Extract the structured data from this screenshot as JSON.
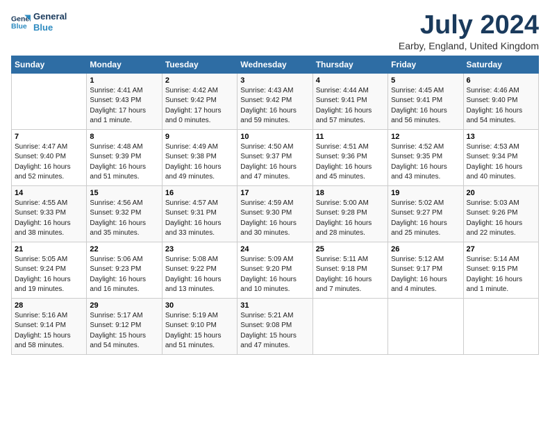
{
  "logo": {
    "line1": "General",
    "line2": "Blue"
  },
  "title": "July 2024",
  "subtitle": "Earby, England, United Kingdom",
  "weekdays": [
    "Sunday",
    "Monday",
    "Tuesday",
    "Wednesday",
    "Thursday",
    "Friday",
    "Saturday"
  ],
  "weeks": [
    [
      {
        "day": "",
        "info": ""
      },
      {
        "day": "1",
        "info": "Sunrise: 4:41 AM\nSunset: 9:43 PM\nDaylight: 17 hours\nand 1 minute."
      },
      {
        "day": "2",
        "info": "Sunrise: 4:42 AM\nSunset: 9:42 PM\nDaylight: 17 hours\nand 0 minutes."
      },
      {
        "day": "3",
        "info": "Sunrise: 4:43 AM\nSunset: 9:42 PM\nDaylight: 16 hours\nand 59 minutes."
      },
      {
        "day": "4",
        "info": "Sunrise: 4:44 AM\nSunset: 9:41 PM\nDaylight: 16 hours\nand 57 minutes."
      },
      {
        "day": "5",
        "info": "Sunrise: 4:45 AM\nSunset: 9:41 PM\nDaylight: 16 hours\nand 56 minutes."
      },
      {
        "day": "6",
        "info": "Sunrise: 4:46 AM\nSunset: 9:40 PM\nDaylight: 16 hours\nand 54 minutes."
      }
    ],
    [
      {
        "day": "7",
        "info": "Sunrise: 4:47 AM\nSunset: 9:40 PM\nDaylight: 16 hours\nand 52 minutes."
      },
      {
        "day": "8",
        "info": "Sunrise: 4:48 AM\nSunset: 9:39 PM\nDaylight: 16 hours\nand 51 minutes."
      },
      {
        "day": "9",
        "info": "Sunrise: 4:49 AM\nSunset: 9:38 PM\nDaylight: 16 hours\nand 49 minutes."
      },
      {
        "day": "10",
        "info": "Sunrise: 4:50 AM\nSunset: 9:37 PM\nDaylight: 16 hours\nand 47 minutes."
      },
      {
        "day": "11",
        "info": "Sunrise: 4:51 AM\nSunset: 9:36 PM\nDaylight: 16 hours\nand 45 minutes."
      },
      {
        "day": "12",
        "info": "Sunrise: 4:52 AM\nSunset: 9:35 PM\nDaylight: 16 hours\nand 43 minutes."
      },
      {
        "day": "13",
        "info": "Sunrise: 4:53 AM\nSunset: 9:34 PM\nDaylight: 16 hours\nand 40 minutes."
      }
    ],
    [
      {
        "day": "14",
        "info": "Sunrise: 4:55 AM\nSunset: 9:33 PM\nDaylight: 16 hours\nand 38 minutes."
      },
      {
        "day": "15",
        "info": "Sunrise: 4:56 AM\nSunset: 9:32 PM\nDaylight: 16 hours\nand 35 minutes."
      },
      {
        "day": "16",
        "info": "Sunrise: 4:57 AM\nSunset: 9:31 PM\nDaylight: 16 hours\nand 33 minutes."
      },
      {
        "day": "17",
        "info": "Sunrise: 4:59 AM\nSunset: 9:30 PM\nDaylight: 16 hours\nand 30 minutes."
      },
      {
        "day": "18",
        "info": "Sunrise: 5:00 AM\nSunset: 9:28 PM\nDaylight: 16 hours\nand 28 minutes."
      },
      {
        "day": "19",
        "info": "Sunrise: 5:02 AM\nSunset: 9:27 PM\nDaylight: 16 hours\nand 25 minutes."
      },
      {
        "day": "20",
        "info": "Sunrise: 5:03 AM\nSunset: 9:26 PM\nDaylight: 16 hours\nand 22 minutes."
      }
    ],
    [
      {
        "day": "21",
        "info": "Sunrise: 5:05 AM\nSunset: 9:24 PM\nDaylight: 16 hours\nand 19 minutes."
      },
      {
        "day": "22",
        "info": "Sunrise: 5:06 AM\nSunset: 9:23 PM\nDaylight: 16 hours\nand 16 minutes."
      },
      {
        "day": "23",
        "info": "Sunrise: 5:08 AM\nSunset: 9:22 PM\nDaylight: 16 hours\nand 13 minutes."
      },
      {
        "day": "24",
        "info": "Sunrise: 5:09 AM\nSunset: 9:20 PM\nDaylight: 16 hours\nand 10 minutes."
      },
      {
        "day": "25",
        "info": "Sunrise: 5:11 AM\nSunset: 9:18 PM\nDaylight: 16 hours\nand 7 minutes."
      },
      {
        "day": "26",
        "info": "Sunrise: 5:12 AM\nSunset: 9:17 PM\nDaylight: 16 hours\nand 4 minutes."
      },
      {
        "day": "27",
        "info": "Sunrise: 5:14 AM\nSunset: 9:15 PM\nDaylight: 16 hours\nand 1 minute."
      }
    ],
    [
      {
        "day": "28",
        "info": "Sunrise: 5:16 AM\nSunset: 9:14 PM\nDaylight: 15 hours\nand 58 minutes."
      },
      {
        "day": "29",
        "info": "Sunrise: 5:17 AM\nSunset: 9:12 PM\nDaylight: 15 hours\nand 54 minutes."
      },
      {
        "day": "30",
        "info": "Sunrise: 5:19 AM\nSunset: 9:10 PM\nDaylight: 15 hours\nand 51 minutes."
      },
      {
        "day": "31",
        "info": "Sunrise: 5:21 AM\nSunset: 9:08 PM\nDaylight: 15 hours\nand 47 minutes."
      },
      {
        "day": "",
        "info": ""
      },
      {
        "day": "",
        "info": ""
      },
      {
        "day": "",
        "info": ""
      }
    ]
  ]
}
